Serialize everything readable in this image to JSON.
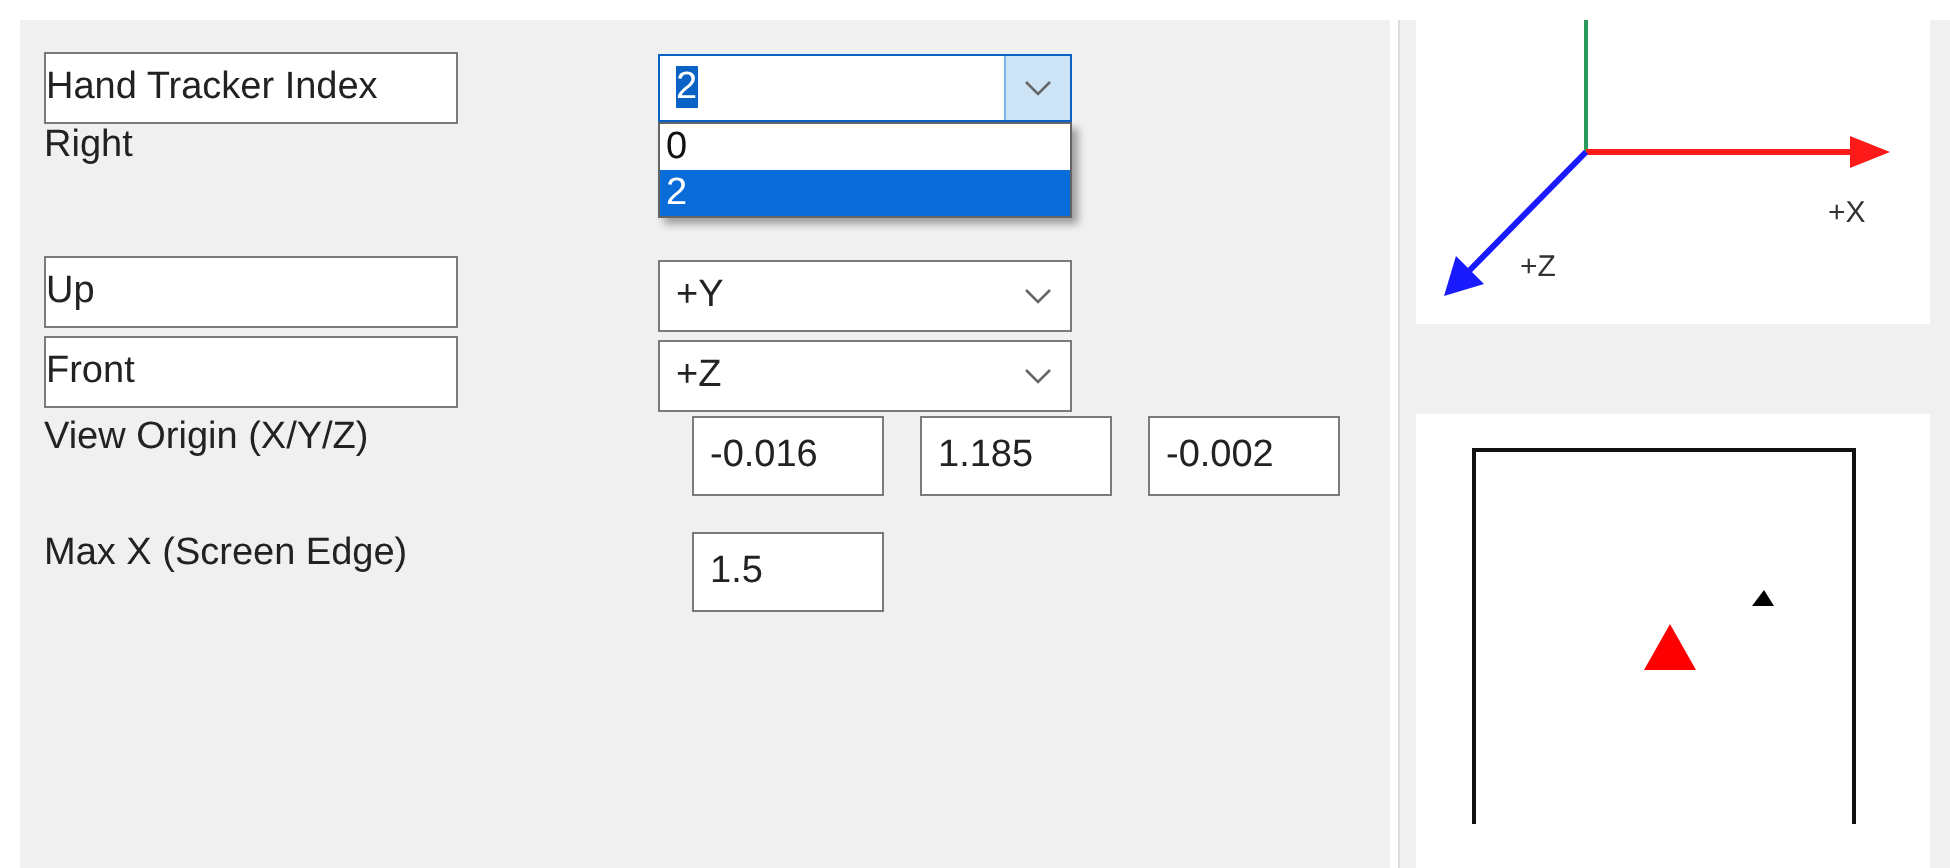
{
  "settings": [
    {
      "kind": "combo",
      "label": "Hand Tracker Index",
      "value": "2",
      "open": true,
      "options": [
        {
          "text": "0",
          "selected": false
        },
        {
          "text": "2",
          "selected": true
        }
      ]
    },
    {
      "kind": "label",
      "label": "Right"
    },
    {
      "kind": "combo",
      "label": "Up",
      "value": "+Y",
      "open": false
    },
    {
      "kind": "combo",
      "label": "Front",
      "value": "+Z",
      "open": false
    },
    {
      "kind": "fields",
      "label": "View Origin (X/Y/Z)",
      "values": [
        "-0.016",
        "1.185",
        "-0.002"
      ]
    },
    {
      "kind": "fields",
      "label": "Max X (Screen Edge)",
      "values": [
        "1.5"
      ]
    }
  ],
  "axis_view": {
    "x_label": "+X",
    "z_label": "+Z"
  }
}
